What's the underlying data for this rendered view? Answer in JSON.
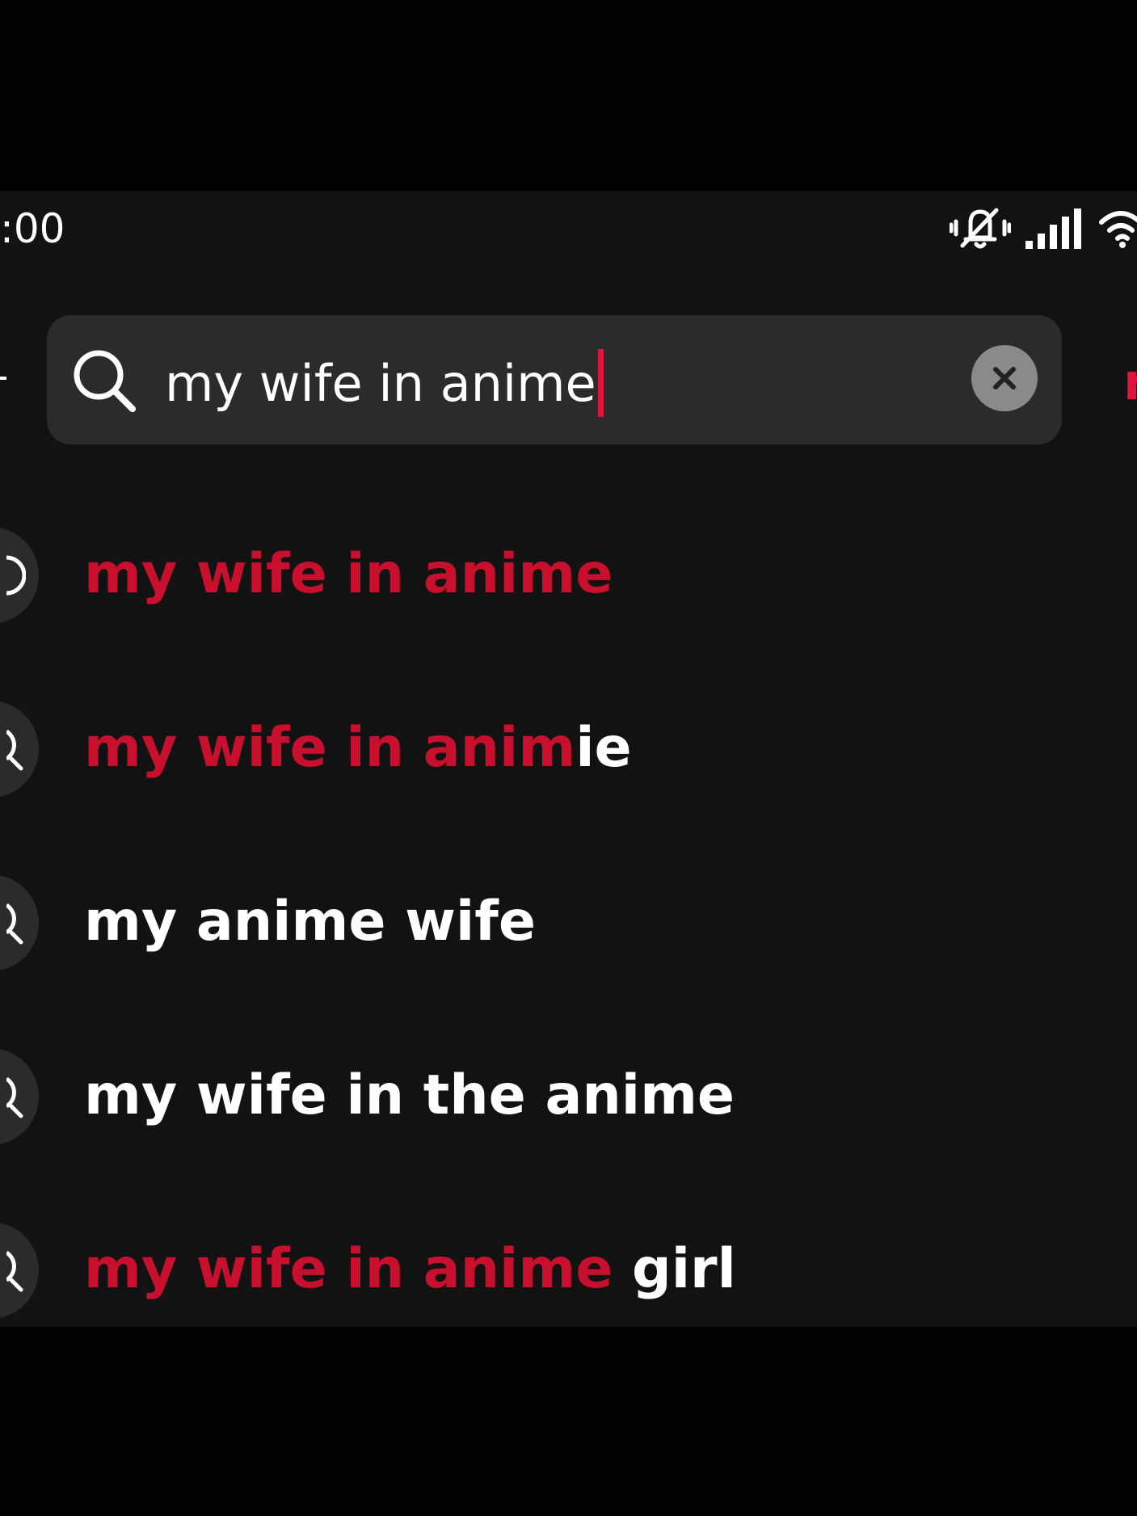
{
  "status_bar": {
    "time": ":00",
    "icons": [
      "vibrate-off-icon",
      "signal-icon",
      "wifi-icon"
    ]
  },
  "search": {
    "query": "my wife in anime",
    "action_partial": "r"
  },
  "suggestions": [
    {
      "icon": "history-icon",
      "highlight": "my wife in anime",
      "rest": ""
    },
    {
      "icon": "search-icon",
      "highlight": "my wife in anim",
      "rest": "ie"
    },
    {
      "icon": "search-icon",
      "highlight": "",
      "rest": "my anime wife"
    },
    {
      "icon": "search-icon",
      "highlight": "",
      "rest": "my wife in the anime"
    },
    {
      "icon": "search-icon",
      "highlight": "my wife in anime",
      "rest": " girl"
    }
  ],
  "colors": {
    "accent": "#c8102e",
    "caret": "#e0143a",
    "background": "#121212",
    "search_bar": "#2b2b2d"
  }
}
